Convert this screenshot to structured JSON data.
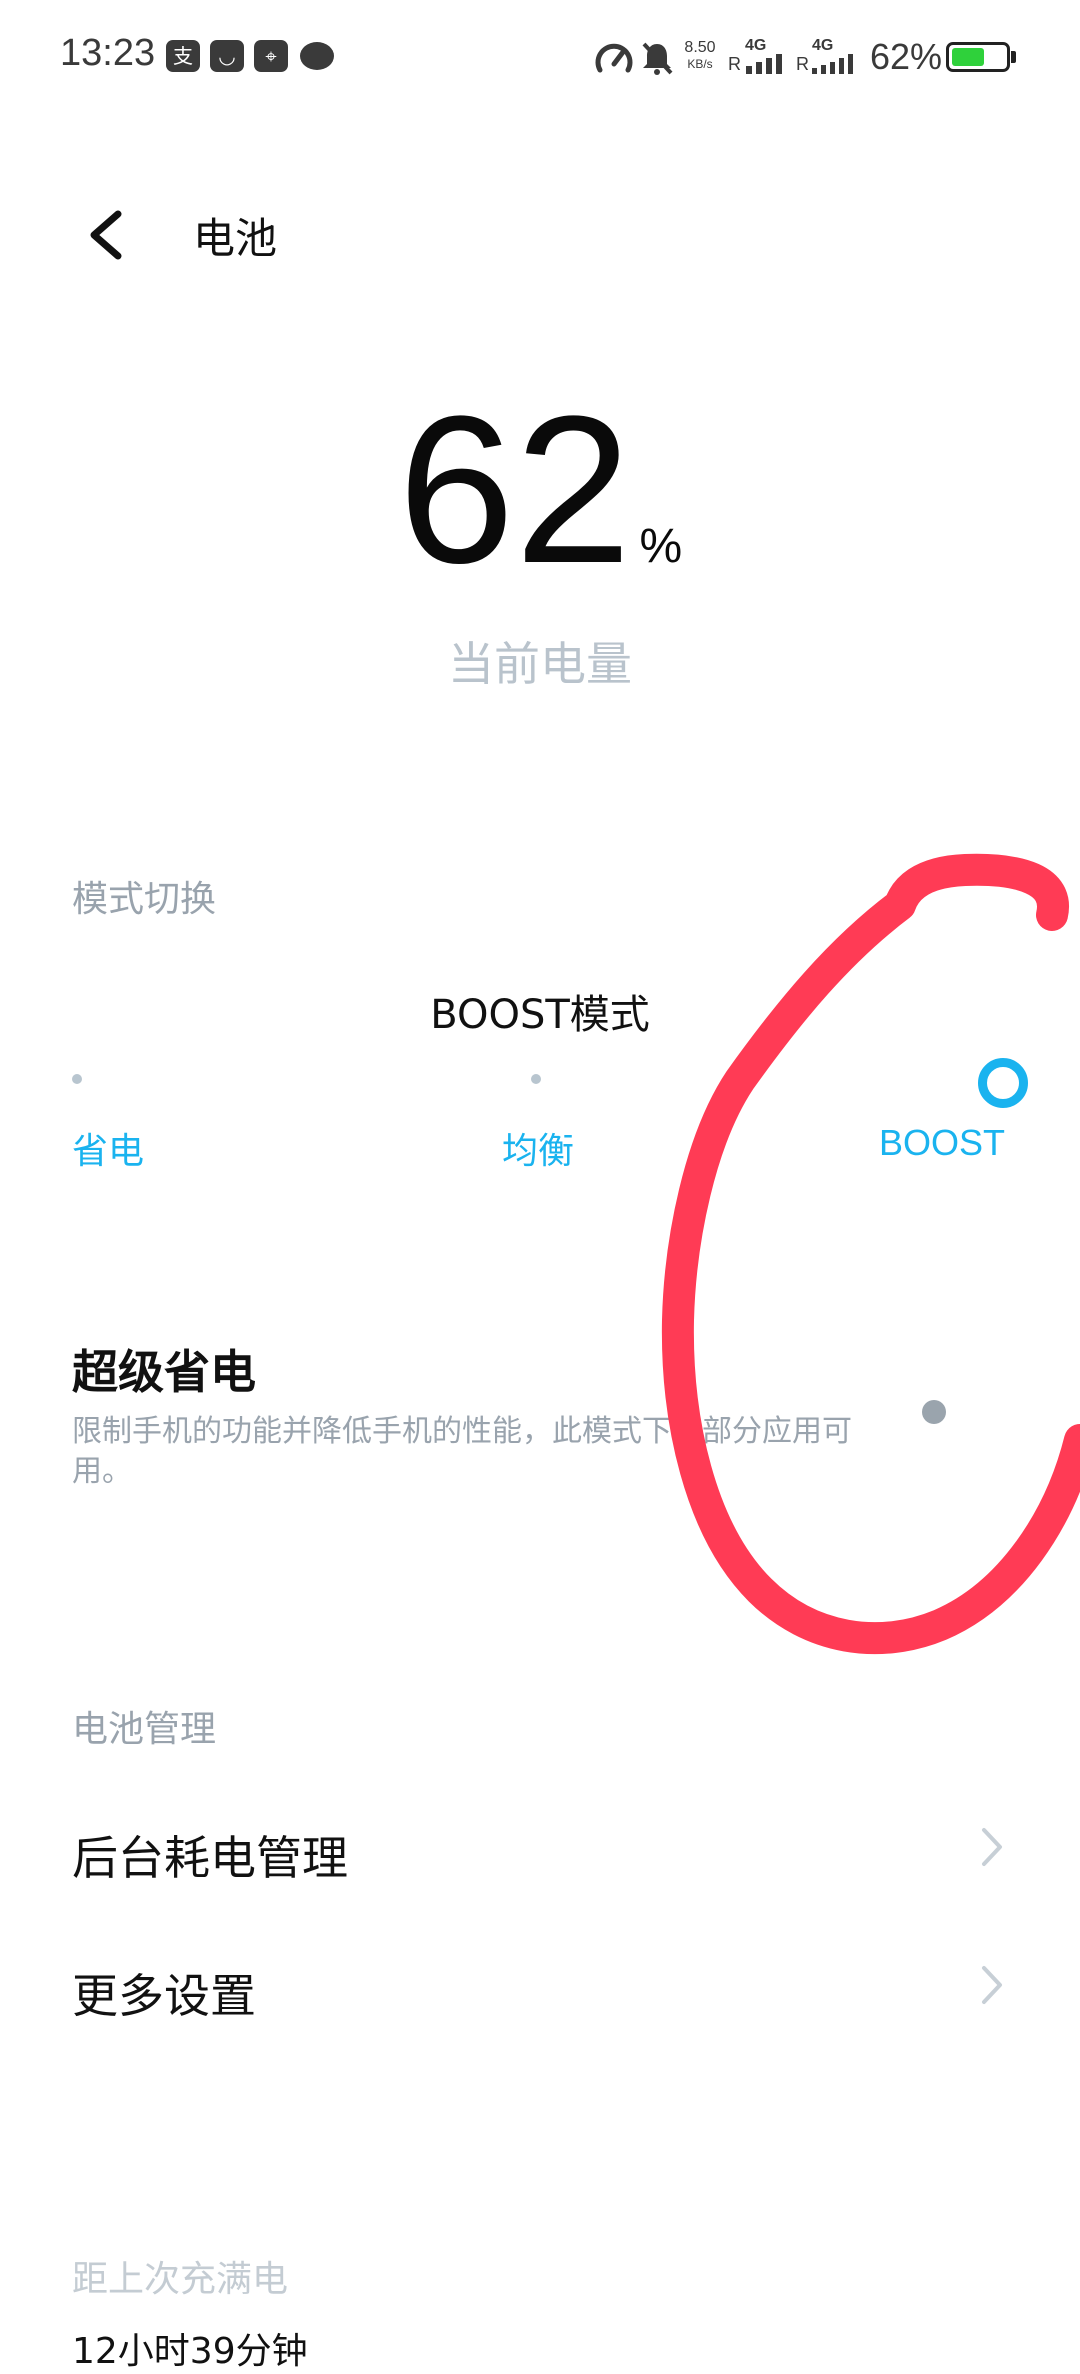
{
  "status_bar": {
    "time": "13:23",
    "notification_icons": [
      {
        "name": "alipay-icon",
        "glyph": "支"
      },
      {
        "name": "shopping-bag-icon",
        "glyph": "◡"
      },
      {
        "name": "map-icon",
        "glyph": "⌖"
      },
      {
        "name": "chat-bubble-icon",
        "glyph": "●"
      }
    ],
    "speed_value": "8.50",
    "speed_unit": "KB/s",
    "network_1": "4G",
    "network_2": "4G",
    "roaming": "R",
    "battery_percent": "62%",
    "battery_level": 0.62,
    "battery_color": "#2fd13b"
  },
  "header": {
    "title": "电池"
  },
  "battery": {
    "level": "62",
    "unit": "%",
    "caption": "当前电量"
  },
  "mode_switch": {
    "section_label": "模式切换",
    "current_mode": "BOOST模式",
    "options": [
      "省电",
      "均衡",
      "BOOST"
    ],
    "selected": "BOOST",
    "accent_color": "#1ab3ef"
  },
  "super_saving": {
    "title": "超级省电",
    "description": "限制手机的功能并降低手机的性能，此模式下仅部分应用可用。",
    "enabled": false
  },
  "battery_management": {
    "section_label": "电池管理",
    "items": [
      {
        "label": "后台耗电管理"
      },
      {
        "label": "更多设置"
      }
    ]
  },
  "last_full_charge": {
    "label": "距上次充满电",
    "value": "12小时39分钟"
  },
  "annotation": {
    "color": "#ff3b55"
  }
}
